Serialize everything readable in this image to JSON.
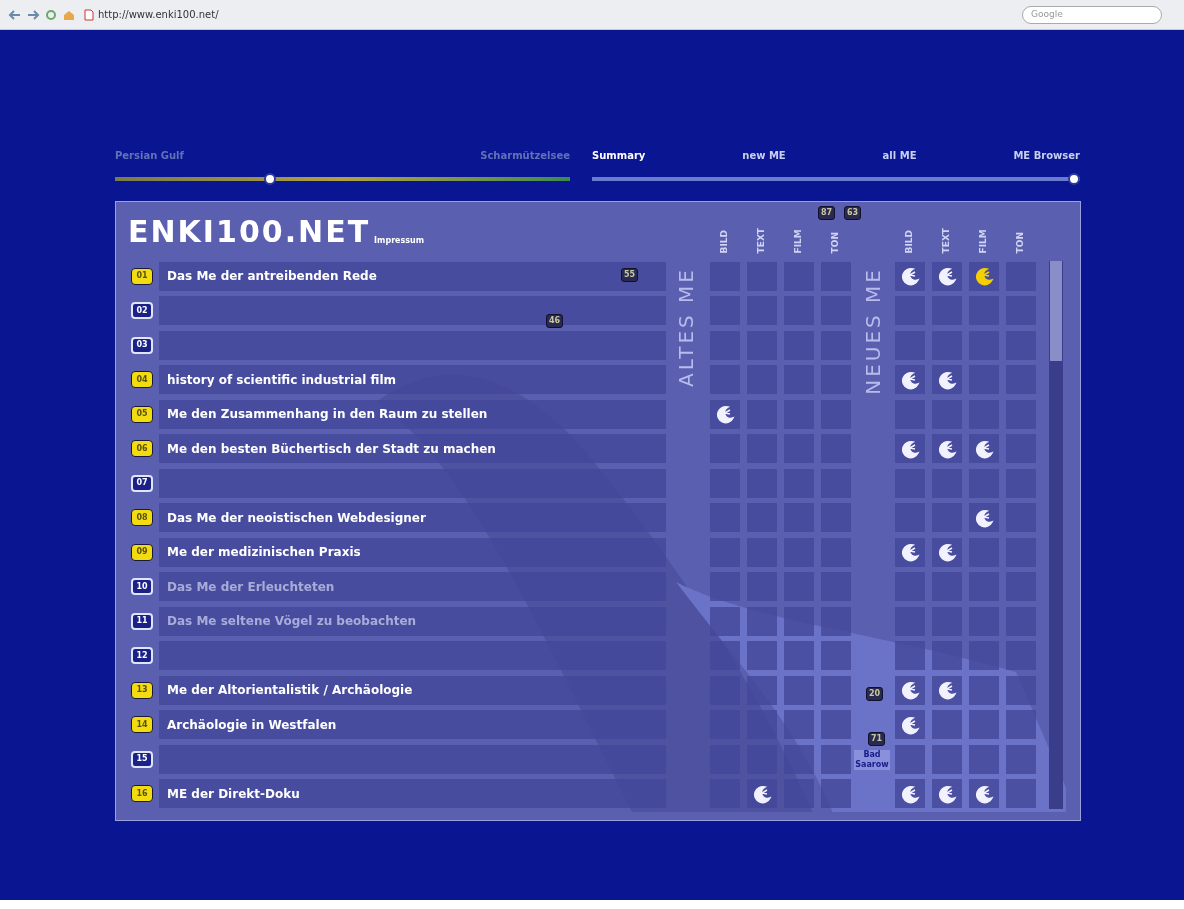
{
  "browser": {
    "url": "http://www.enki100.net/",
    "search_placeholder": "Google"
  },
  "location_slider": {
    "start_label": "Persian Gulf",
    "end_label": "Scharmützelsee",
    "level": 0.34
  },
  "view_slider": {
    "labels": [
      "Summary",
      "new ME",
      "all ME",
      "ME Browser"
    ],
    "level": 1.0
  },
  "header": {
    "logo": "ENKI100.NET",
    "link": "Impressum",
    "altes_label": "ALTES ME",
    "neues_label": "NEUES ME",
    "altes_columns": [
      "BILD",
      "TEXT",
      "FILM",
      "TON"
    ],
    "neues_columns": [
      "BILD",
      "TEXT",
      "FILM",
      "TON"
    ]
  },
  "rows": [
    {
      "number": "01",
      "title": "Das Me der antreibenden Rede",
      "active": true,
      "altes": [
        {
          "on": false
        },
        {
          "on": false
        },
        {
          "on": false
        },
        {
          "on": false
        }
      ],
      "neues": [
        {
          "on": true,
          "color": "#f2f2ff"
        },
        {
          "on": true,
          "color": "#f2f2ff"
        },
        {
          "on": true,
          "color": "#f5d000"
        },
        {
          "on": false
        }
      ]
    },
    {
      "number": "02",
      "active": false,
      "altes": [
        {
          "on": false
        },
        {
          "on": false
        },
        {
          "on": false
        },
        {
          "on": false
        }
      ],
      "neues": [
        {
          "on": false
        },
        {
          "on": false
        },
        {
          "on": false
        },
        {
          "on": false
        }
      ]
    },
    {
      "number": "03",
      "active": false,
      "altes": [
        {
          "on": false
        },
        {
          "on": false
        },
        {
          "on": false
        },
        {
          "on": false
        }
      ],
      "neues": [
        {
          "on": false
        },
        {
          "on": false
        },
        {
          "on": false
        },
        {
          "on": false
        }
      ]
    },
    {
      "number": "04",
      "title": "history of scientific industrial film",
      "active": true,
      "altes": [
        {
          "on": false
        },
        {
          "on": false
        },
        {
          "on": false
        },
        {
          "on": false
        }
      ],
      "neues": [
        {
          "on": true,
          "color": "#f2f2ff"
        },
        {
          "on": true,
          "color": "#f2f2ff"
        },
        {
          "on": false
        },
        {
          "on": false
        }
      ]
    },
    {
      "number": "05",
      "title": "Me den Zusammenhang in den Raum zu stellen",
      "active": true,
      "altes": [
        {
          "on": true,
          "color": "#f2f2ff"
        },
        {
          "on": false
        },
        {
          "on": false
        },
        {
          "on": false
        }
      ],
      "neues": [
        {
          "on": false
        },
        {
          "on": false
        },
        {
          "on": false
        },
        {
          "on": false
        }
      ]
    },
    {
      "number": "06",
      "title": "Me den besten Büchertisch der Stadt zu machen",
      "active": true,
      "altes": [
        {
          "on": false
        },
        {
          "on": false
        },
        {
          "on": false
        },
        {
          "on": false
        }
      ],
      "neues": [
        {
          "on": true,
          "color": "#f2f2ff"
        },
        {
          "on": true,
          "color": "#f2f2ff"
        },
        {
          "on": true,
          "color": "#f2f2ff"
        },
        {
          "on": false
        }
      ]
    },
    {
      "number": "07",
      "active": false,
      "altes": [
        {
          "on": false
        },
        {
          "on": false
        },
        {
          "on": false
        },
        {
          "on": false
        }
      ],
      "neues": [
        {
          "on": false
        },
        {
          "on": false
        },
        {
          "on": false
        },
        {
          "on": false
        }
      ]
    },
    {
      "number": "08",
      "title": "Das Me der neoistischen Webdesigner",
      "active": true,
      "altes": [
        {
          "on": false
        },
        {
          "on": false
        },
        {
          "on": false
        },
        {
          "on": false
        }
      ],
      "neues": [
        {
          "on": false
        },
        {
          "on": false
        },
        {
          "on": true,
          "color": "#f2f2ff"
        },
        {
          "on": false
        }
      ]
    },
    {
      "number": "09",
      "title": "Me der medizinischen Praxis",
      "active": true,
      "altes": [
        {
          "on": false
        },
        {
          "on": false
        },
        {
          "on": false
        },
        {
          "on": false
        }
      ],
      "neues": [
        {
          "on": true,
          "color": "#f2f2ff"
        },
        {
          "on": true,
          "color": "#f2f2ff"
        },
        {
          "on": false
        },
        {
          "on": false
        }
      ]
    },
    {
      "number": "10",
      "title": "Das Me der Erleuchteten",
      "active": false,
      "altes": [
        {
          "on": false
        },
        {
          "on": false
        },
        {
          "on": false
        },
        {
          "on": false
        }
      ],
      "neues": [
        {
          "on": false
        },
        {
          "on": false
        },
        {
          "on": false
        },
        {
          "on": false
        }
      ]
    },
    {
      "number": "11",
      "title": "Das Me seltene Vögel zu beobachten",
      "active": false,
      "altes": [
        {
          "on": false
        },
        {
          "on": false
        },
        {
          "on": false
        },
        {
          "on": false
        }
      ],
      "neues": [
        {
          "on": false
        },
        {
          "on": false
        },
        {
          "on": false
        },
        {
          "on": false
        }
      ]
    },
    {
      "number": "12",
      "active": false,
      "altes": [
        {
          "on": false
        },
        {
          "on": false
        },
        {
          "on": false
        },
        {
          "on": false
        }
      ],
      "neues": [
        {
          "on": false
        },
        {
          "on": false
        },
        {
          "on": false
        },
        {
          "on": false
        }
      ]
    },
    {
      "number": "13",
      "title": "Me der Altorientalistik / Archäologie",
      "active": true,
      "altes": [
        {
          "on": false
        },
        {
          "on": false
        },
        {
          "on": false
        },
        {
          "on": false
        }
      ],
      "neues": [
        {
          "on": true,
          "color": "#f2f2ff"
        },
        {
          "on": true,
          "color": "#f2f2ff"
        },
        {
          "on": false
        },
        {
          "on": false
        }
      ]
    },
    {
      "number": "14",
      "title": "Archäologie in Westfalen",
      "active": true,
      "altes": [
        {
          "on": false
        },
        {
          "on": false
        },
        {
          "on": false
        },
        {
          "on": false
        }
      ],
      "neues": [
        {
          "on": true,
          "color": "#f2f2ff"
        },
        {
          "on": false
        },
        {
          "on": false
        },
        {
          "on": false
        }
      ]
    },
    {
      "number": "15",
      "active": false,
      "altes": [
        {
          "on": false
        },
        {
          "on": false
        },
        {
          "on": false
        },
        {
          "on": false
        }
      ],
      "neues": [
        {
          "on": false
        },
        {
          "on": false
        },
        {
          "on": false
        },
        {
          "on": false
        }
      ]
    },
    {
      "number": "16",
      "title": "ME der Direkt-Doku",
      "active": true,
      "altes": [
        {
          "on": false
        },
        {
          "on": true,
          "color": "#f2f2ff"
        },
        {
          "on": false
        },
        {
          "on": false
        }
      ],
      "neues": [
        {
          "on": true,
          "color": "#f2f2ff"
        },
        {
          "on": true,
          "color": "#f2f2ff"
        },
        {
          "on": true,
          "color": "#f2f2ff"
        },
        {
          "on": false
        }
      ]
    }
  ],
  "map": {
    "place_label": "Bad Saarow",
    "markers": [
      "55",
      "46",
      "87",
      "63",
      "20",
      "71"
    ]
  }
}
